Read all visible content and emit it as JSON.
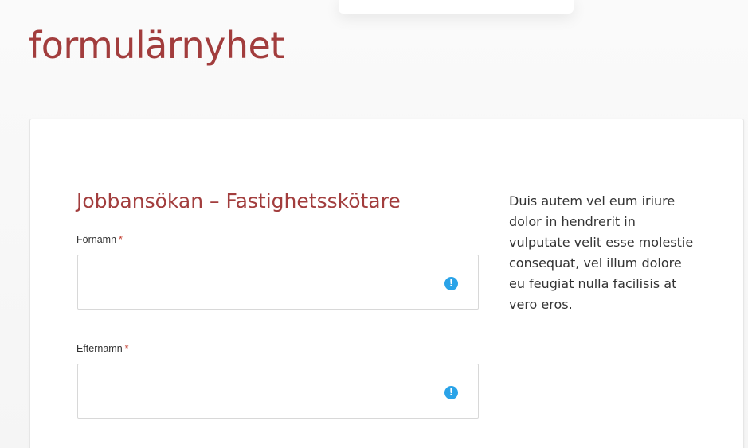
{
  "page": {
    "title": "formulärnyhet"
  },
  "form": {
    "heading": "Jobbansökan – Fastighetsskötare",
    "required_marker": "*",
    "fields": [
      {
        "label": "Förnamn",
        "value": "",
        "placeholder": "",
        "icon": "exclamation-circle-icon"
      },
      {
        "label": "Efternamn",
        "value": "",
        "placeholder": "",
        "icon": "exclamation-circle-icon"
      }
    ],
    "alert_glyph": "!"
  },
  "sidebar": {
    "text": "Duis autem vel eum iriure dolor in hendrerit in vulputate velit esse molestie consequat, vel illum dolore eu feugiat nulla facilisis at vero eros."
  },
  "colors": {
    "title": "#a23d3d",
    "required": "#c0392b",
    "alert_icon": "#2aa3e8"
  }
}
